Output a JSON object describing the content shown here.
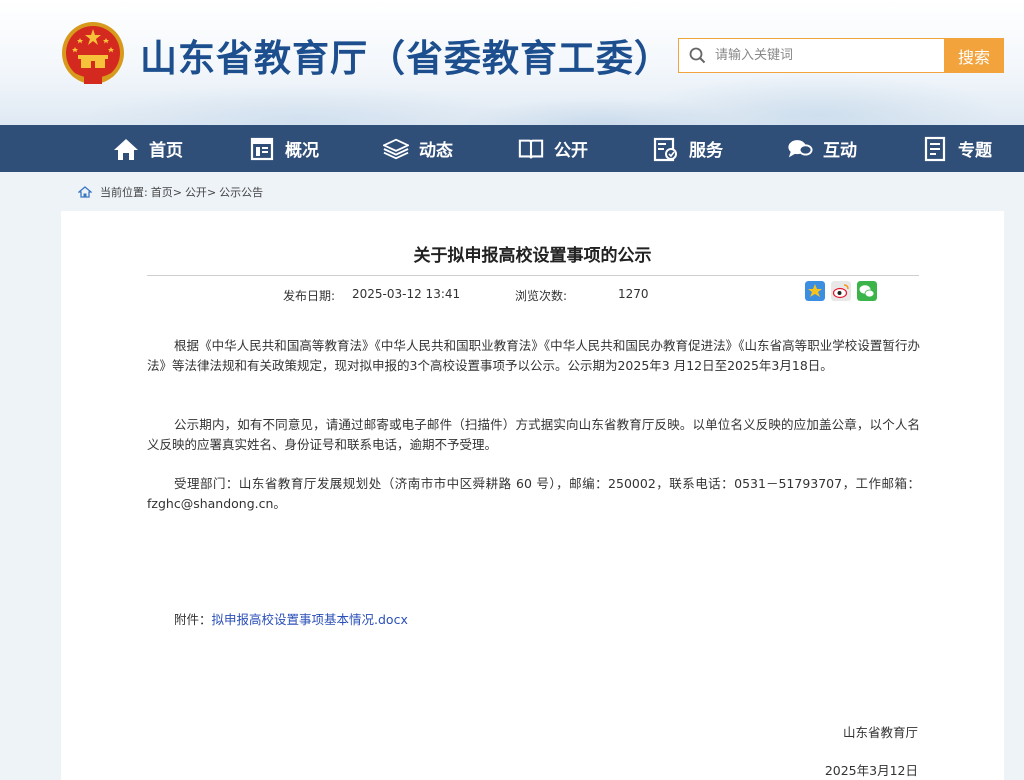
{
  "header": {
    "site_title": "山东省教育厅（省委教育工委）",
    "search_placeholder": "请输入关键词",
    "search_button": "搜索"
  },
  "nav": {
    "items": [
      {
        "label": "首页",
        "icon": "home-icon"
      },
      {
        "label": "概况",
        "icon": "overview-icon"
      },
      {
        "label": "动态",
        "icon": "news-icon"
      },
      {
        "label": "公开",
        "icon": "book-icon"
      },
      {
        "label": "服务",
        "icon": "service-icon"
      },
      {
        "label": "互动",
        "icon": "chat-icon"
      },
      {
        "label": "专题",
        "icon": "topic-icon"
      }
    ]
  },
  "breadcrumb": {
    "prefix": "当前位置:",
    "items": [
      "首页",
      "公开",
      "公示公告"
    ],
    "sep": ">"
  },
  "article": {
    "title": "关于拟申报高校设置事项的公示",
    "publish_label": "发布日期:",
    "publish_date": "2025-03-12 13:41",
    "views_label": "浏览次数:",
    "views": "1270",
    "paragraphs": [
      "根据《中华人民共和国高等教育法》《中华人民共和国职业教育法》《中华人民共和国民办教育促进法》《山东省高等职业学校设置暂行办法》等法律法规和有关政策规定，现对拟申报的3个高校设置事项予以公示。公示期为2025年3 月12日至2025年3月18日。",
      "公示期内，如有不同意见，请通过邮寄或电子邮件（扫描件）方式据实向山东省教育厅反映。以单位名义反映的应加盖公章，以个人名义反映的应署真实姓名、身份证号和联系电话，逾期不予受理。",
      "受理部门：山东省教育厅发展规划处（济南市市中区舜耕路 60 号），邮编：250002，联系电话：0531－51793707，工作邮箱：fzghc@shandong.cn。"
    ],
    "attachment_label": "附件：",
    "attachment_link": "拟申报高校设置事项基本情况.docx",
    "signature_org": "山东省教育厅",
    "signature_date": "2025年3月12日"
  },
  "colors": {
    "nav_bg": "#2f4e78",
    "title_blue": "#1d4f8e",
    "accent_orange": "#f2a33c",
    "link_blue": "#2a4fb8"
  }
}
